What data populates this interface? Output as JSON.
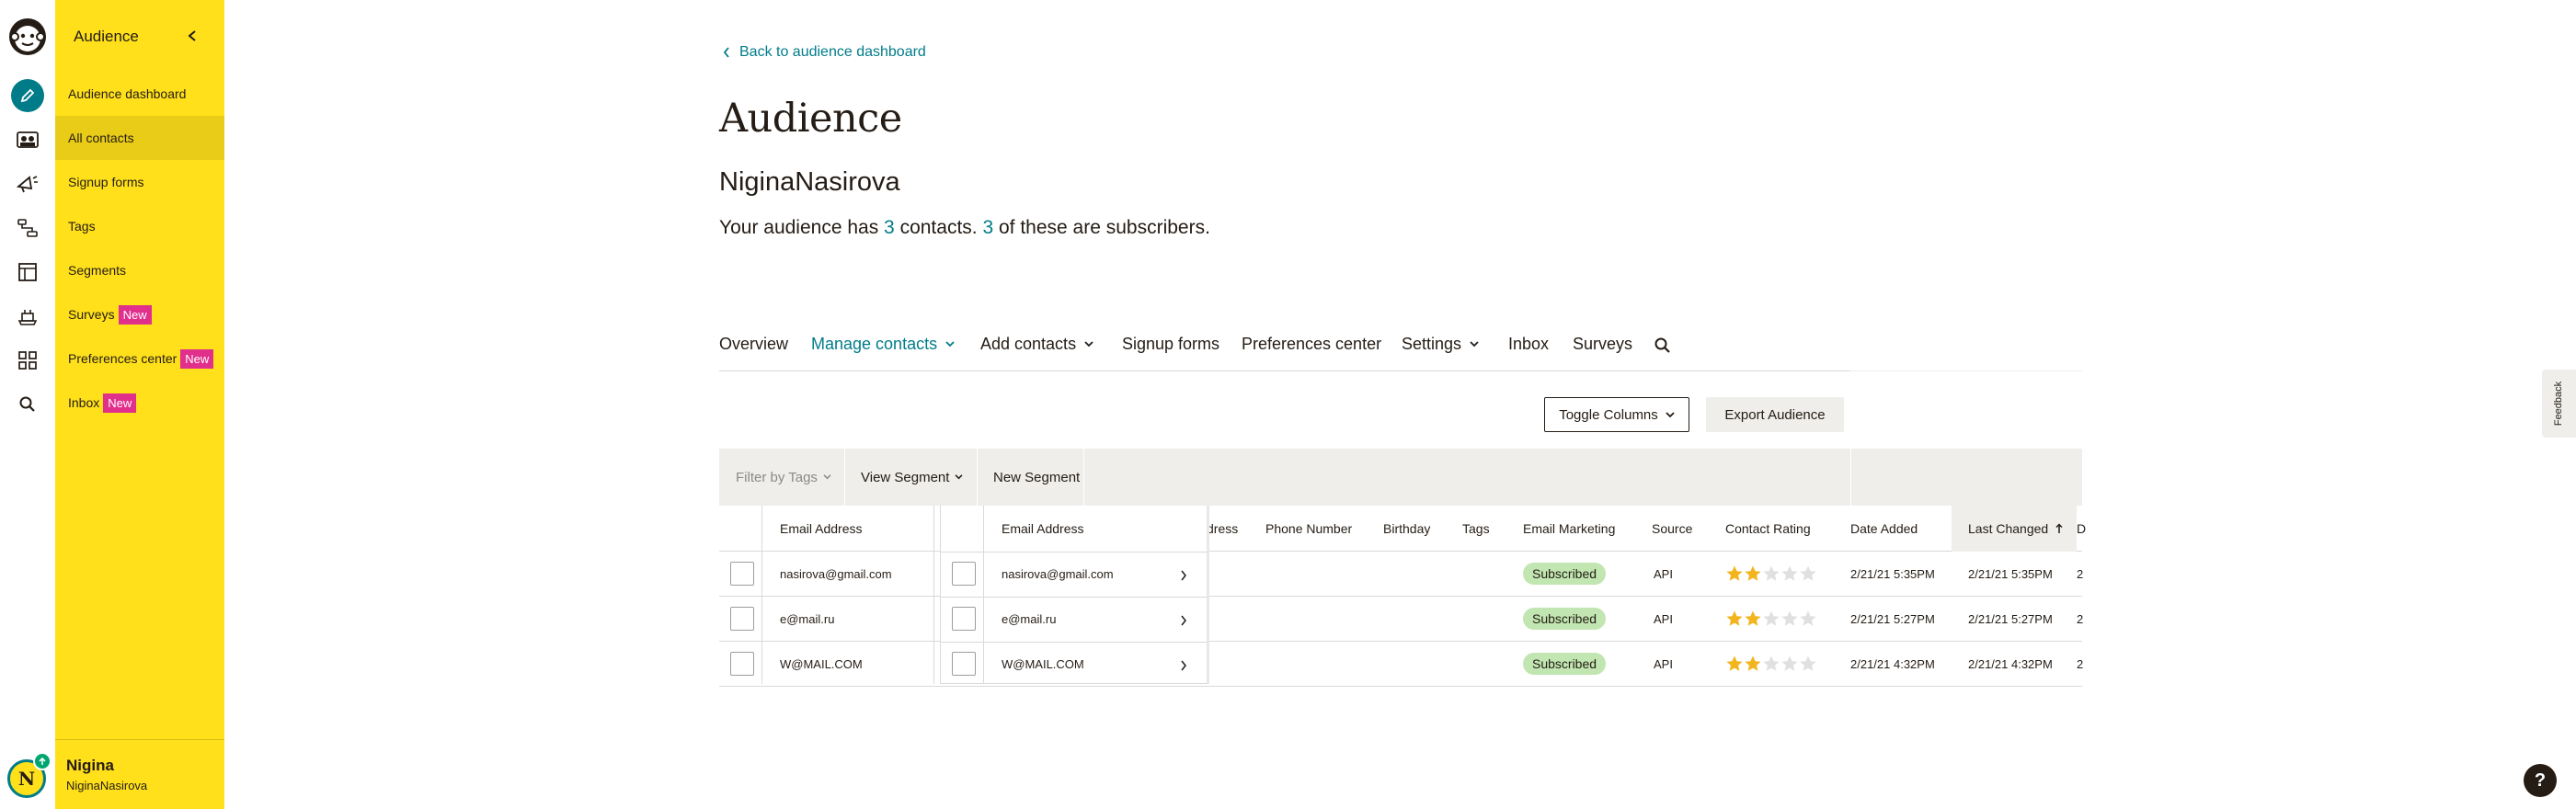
{
  "rail": {
    "icons": [
      "mailchimp-logo",
      "pencil-icon",
      "audience-icon",
      "megaphone-icon",
      "automation-icon",
      "website-icon",
      "content-icon",
      "grid-icon",
      "search-icon"
    ],
    "avatar_letter": "N"
  },
  "sidenav": {
    "title": "Audience",
    "items": [
      {
        "label": "Audience dashboard",
        "badge": ""
      },
      {
        "label": "All contacts",
        "badge": ""
      },
      {
        "label": "Signup forms",
        "badge": ""
      },
      {
        "label": "Tags",
        "badge": ""
      },
      {
        "label": "Segments",
        "badge": ""
      },
      {
        "label": "Surveys",
        "badge": "New"
      },
      {
        "label": "Preferences center",
        "badge": "New"
      },
      {
        "label": "Inbox",
        "badge": "New"
      }
    ],
    "active_item": "All contacts",
    "footer": {
      "name": "Nigina",
      "account": "NiginaNasirova"
    }
  },
  "main": {
    "back_link": "Back to audience dashboard",
    "title": "Audience",
    "audience_name": "NiginaNasirova",
    "summary": {
      "prefix": "Your audience has ",
      "contacts": "3",
      "middle": " contacts. ",
      "subscribers": "3",
      "suffix": " of these are subscribers."
    },
    "tabs": [
      {
        "label": "Overview"
      },
      {
        "label": "Manage contacts",
        "active": true
      },
      {
        "label": "Add contacts"
      },
      {
        "label": "Signup forms"
      },
      {
        "label": "Preferences center"
      },
      {
        "label": "Settings"
      },
      {
        "label": "Inbox"
      },
      {
        "label": "Surveys"
      }
    ],
    "toggle_columns": "Toggle Columns",
    "export_audience": "Export Audience",
    "filter_tags": "Filter by Tags",
    "view_segment": "View Segment",
    "new_segment": "New Segment"
  },
  "table": {
    "headers": {
      "email": "Email Address",
      "address_partial": "dress",
      "phone": "Phone Number",
      "birthday": "Birthday",
      "tags": "Tags",
      "email_marketing": "Email Marketing",
      "source": "Source",
      "contact_rating": "Contact Rating",
      "date_added": "Date Added",
      "last_changed": "Last Changed",
      "partial_next": "D"
    },
    "rows": [
      {
        "email": "nasirova@gmail.com",
        "status": "Subscribed",
        "source": "API",
        "rating": 2,
        "date_added": "2/21/21 5:35PM",
        "last_changed": "2/21/21 5:35PM",
        "partial": "2"
      },
      {
        "email": "e@mail.ru",
        "status": "Subscribed",
        "source": "API",
        "rating": 2,
        "date_added": "2/21/21 5:27PM",
        "last_changed": "2/21/21 5:27PM",
        "partial": "2"
      },
      {
        "email": "W@MAIL.COM",
        "status": "Subscribed",
        "source": "API",
        "rating": 2,
        "date_added": "2/21/21 4:32PM",
        "last_changed": "2/21/21 4:32PM",
        "partial": "2"
      }
    ]
  },
  "widgets": {
    "feedback": "Feedback",
    "help": "?"
  },
  "colors": {
    "brand_yellow": "#ffe01b",
    "teal": "#007c89",
    "pink_badge": "#e12f8c",
    "subscribed_green": "#c1e6b1",
    "star": "#f2b51e"
  }
}
